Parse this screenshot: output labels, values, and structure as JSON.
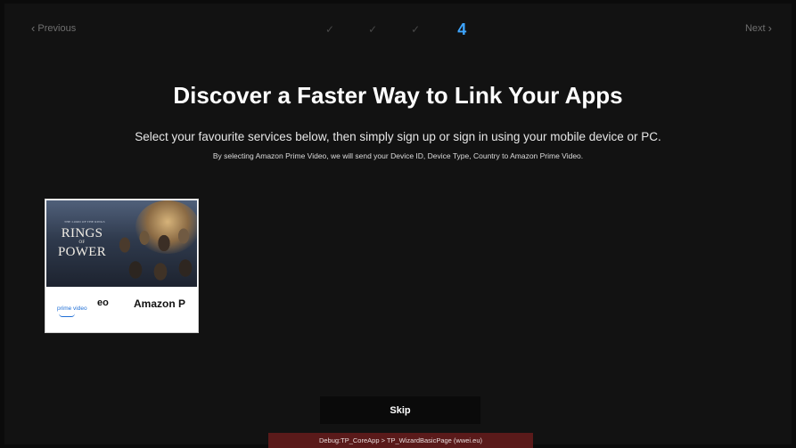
{
  "nav": {
    "previous_label": "Previous",
    "next_label": "Next",
    "previous_icon": "chevron-left-icon",
    "next_icon": "chevron-right-icon"
  },
  "steps": {
    "completed_symbol": "✓",
    "completed_count": 3,
    "current_label": "4"
  },
  "header": {
    "title": "Discover a Faster Way to Link Your Apps",
    "subtitle": "Select your favourite services below, then simply sign up or sign in using your mobile device or PC.",
    "disclaimer": "By selecting Amazon Prime Video, we will send your Device ID, Device Type, Country to Amazon Prime Video."
  },
  "services": [
    {
      "poster_tagline": "THE LORD OF THE RINGS",
      "poster_title_line1": "RINGS",
      "poster_title_of": "OF",
      "poster_title_line2": "POWER",
      "logo_text": "prime video",
      "fragment_text": "eo",
      "name": "Amazon P"
    }
  ],
  "actions": {
    "skip_label": "Skip"
  },
  "debug": {
    "text": "Debug:TP_CoreApp > TP_WizardBasicPage (wwei.eu)"
  },
  "colors": {
    "accent": "#3ea6ff",
    "background": "#121212",
    "debug_bar": "#5a1a1a"
  }
}
